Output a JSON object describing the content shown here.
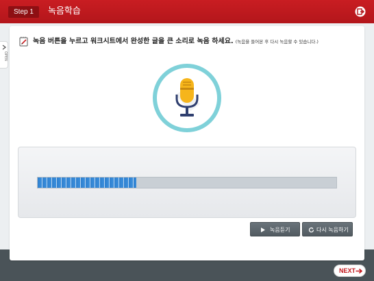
{
  "header": {
    "step": "Step 1",
    "title": "녹음학습",
    "exit_icon": "exit-icon"
  },
  "side_tab": {
    "label": "OPEN"
  },
  "instruction": {
    "main": "녹음 버튼을 누르고 워크시트에서 완성한 글을 큰 소리로 녹음 하세요.",
    "sub": "(녹음을 들어본 후 다시 녹음할 수 있습니다.)",
    "icon": "edit-icon"
  },
  "recorder": {
    "icon": "microphone-icon",
    "progress_fraction": 0.33,
    "colors": {
      "ring": "#7fd1d9",
      "mic": "#f6b51b",
      "stand": "#2f3f6f",
      "bar_fill": "#2f80cf",
      "track": "#c9cfd5"
    }
  },
  "buttons": {
    "listen": {
      "label": "녹음듣기",
      "icon": "play-icon"
    },
    "rerecord": {
      "label": "다시 녹음하기",
      "icon": "refresh-icon"
    }
  },
  "footer": {
    "next": "NEXT",
    "next_icon": "arrow-right-icon"
  },
  "colors": {
    "brand": "#c91d22",
    "footer_bg": "#4a5358"
  }
}
